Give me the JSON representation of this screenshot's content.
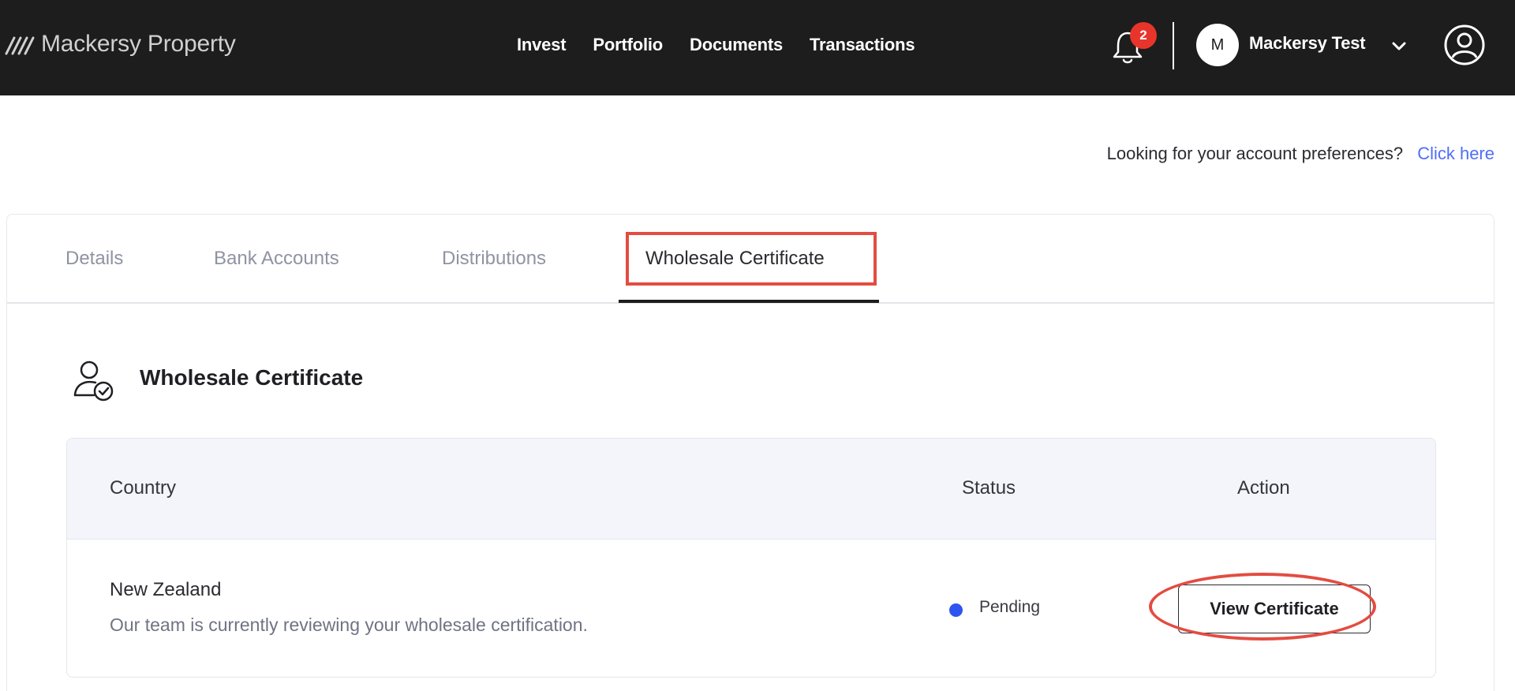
{
  "brand": {
    "name": "Mackersy Property",
    "icon": "stripes-logo-icon"
  },
  "nav": {
    "items": [
      "Invest",
      "Portfolio",
      "Documents",
      "Transactions"
    ]
  },
  "header": {
    "notification_count": "2",
    "avatar_initial": "M",
    "user_name": "Mackersy Test",
    "icons": [
      "bell-icon",
      "chevron-down-icon",
      "user-profile-icon"
    ]
  },
  "preferences": {
    "prompt": "Looking for your account preferences?",
    "link": "Click here"
  },
  "tabs": {
    "items": [
      "Details",
      "Bank Accounts",
      "Distributions",
      "Wholesale Certificate"
    ],
    "active": "Wholesale Certificate"
  },
  "section": {
    "title": "Wholesale Certificate",
    "icon": "user-check-icon"
  },
  "table": {
    "headers": [
      "Country",
      "Status",
      "Action"
    ],
    "rows": [
      {
        "country": "New Zealand",
        "description": "Our team is currently reviewing your wholesale certification.",
        "status": "Pending",
        "action": "View Certificate"
      }
    ]
  },
  "colors": {
    "topbar": "#1d1d1d",
    "link": "#4f6ff5",
    "status_pending": "#2d55f0",
    "highlight": "#e34c41",
    "badge": "#e8352b"
  }
}
